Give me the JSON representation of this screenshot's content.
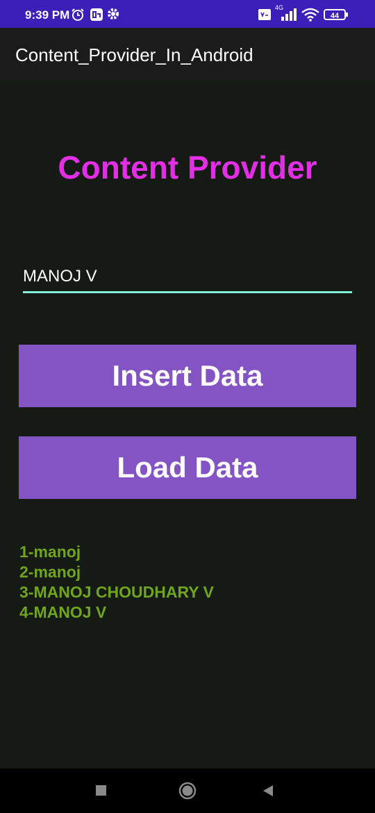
{
  "status_bar": {
    "time": "9:39 PM",
    "icons": [
      "alarm-icon",
      "app-notification-icon",
      "settings-gear-icon",
      "volte-icon",
      "signal-4g-icon",
      "wifi-icon"
    ],
    "network_label": "4G",
    "battery_level": "44"
  },
  "app_bar": {
    "title": "Content_Provider_In_Android"
  },
  "main": {
    "headline": "Content Provider",
    "name_input": {
      "value": "MANOJ V"
    },
    "insert_button": "Insert Data",
    "load_button": "Load Data",
    "results": [
      "1-manoj",
      "2-manoj",
      "3-MANOJ CHOUDHARY V",
      "4-MANOJ V"
    ]
  },
  "nav_bar": {
    "buttons": [
      "recents-square-icon",
      "home-circle-icon",
      "back-triangle-icon"
    ]
  },
  "colors": {
    "status_bar": "#3a1fb8",
    "app_bar": "#1b1b1b",
    "background": "#161a14",
    "headline": "#e22ee4",
    "input_underline": "#80f0d8",
    "button": "#8453c4",
    "results_text": "#6fa51f"
  }
}
